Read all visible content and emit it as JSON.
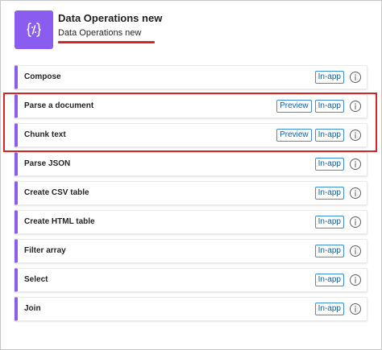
{
  "connector": {
    "icon": "curly-braces-icon",
    "tile_color": "#8b5cf0",
    "title": "Data Operations new",
    "subtitle": "Data Operations new"
  },
  "colors": {
    "accent": "#8b5cf0",
    "highlight": "#d62525",
    "badge": "#0f5fa8"
  },
  "actions": [
    {
      "name": "Compose",
      "preview": "",
      "tag": "In-app"
    },
    {
      "name": "Parse a document",
      "preview": "Preview",
      "tag": "In-app"
    },
    {
      "name": "Chunk text",
      "preview": "Preview",
      "tag": "In-app"
    },
    {
      "name": "Parse JSON",
      "preview": "",
      "tag": "In-app"
    },
    {
      "name": "Create CSV table",
      "preview": "",
      "tag": "In-app"
    },
    {
      "name": "Create HTML table",
      "preview": "",
      "tag": "In-app"
    },
    {
      "name": "Filter array",
      "preview": "",
      "tag": "In-app"
    },
    {
      "name": "Select",
      "preview": "",
      "tag": "In-app"
    },
    {
      "name": "Join",
      "preview": "",
      "tag": "In-app"
    }
  ]
}
